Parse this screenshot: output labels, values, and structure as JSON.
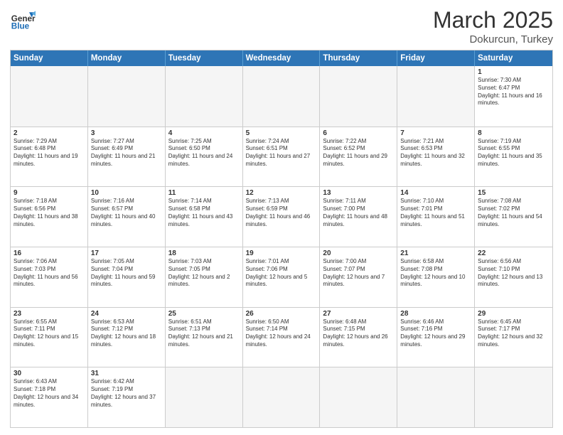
{
  "logo": {
    "text_general": "General",
    "text_blue": "Blue"
  },
  "title": "March 2025",
  "subtitle": "Dokurcun, Turkey",
  "header_days": [
    "Sunday",
    "Monday",
    "Tuesday",
    "Wednesday",
    "Thursday",
    "Friday",
    "Saturday"
  ],
  "weeks": [
    [
      {
        "day": "",
        "info": ""
      },
      {
        "day": "",
        "info": ""
      },
      {
        "day": "",
        "info": ""
      },
      {
        "day": "",
        "info": ""
      },
      {
        "day": "",
        "info": ""
      },
      {
        "day": "",
        "info": ""
      },
      {
        "day": "1",
        "info": "Sunrise: 7:30 AM\nSunset: 6:47 PM\nDaylight: 11 hours and 16 minutes."
      }
    ],
    [
      {
        "day": "2",
        "info": "Sunrise: 7:29 AM\nSunset: 6:48 PM\nDaylight: 11 hours and 19 minutes."
      },
      {
        "day": "3",
        "info": "Sunrise: 7:27 AM\nSunset: 6:49 PM\nDaylight: 11 hours and 21 minutes."
      },
      {
        "day": "4",
        "info": "Sunrise: 7:25 AM\nSunset: 6:50 PM\nDaylight: 11 hours and 24 minutes."
      },
      {
        "day": "5",
        "info": "Sunrise: 7:24 AM\nSunset: 6:51 PM\nDaylight: 11 hours and 27 minutes."
      },
      {
        "day": "6",
        "info": "Sunrise: 7:22 AM\nSunset: 6:52 PM\nDaylight: 11 hours and 29 minutes."
      },
      {
        "day": "7",
        "info": "Sunrise: 7:21 AM\nSunset: 6:53 PM\nDaylight: 11 hours and 32 minutes."
      },
      {
        "day": "8",
        "info": "Sunrise: 7:19 AM\nSunset: 6:55 PM\nDaylight: 11 hours and 35 minutes."
      }
    ],
    [
      {
        "day": "9",
        "info": "Sunrise: 7:18 AM\nSunset: 6:56 PM\nDaylight: 11 hours and 38 minutes."
      },
      {
        "day": "10",
        "info": "Sunrise: 7:16 AM\nSunset: 6:57 PM\nDaylight: 11 hours and 40 minutes."
      },
      {
        "day": "11",
        "info": "Sunrise: 7:14 AM\nSunset: 6:58 PM\nDaylight: 11 hours and 43 minutes."
      },
      {
        "day": "12",
        "info": "Sunrise: 7:13 AM\nSunset: 6:59 PM\nDaylight: 11 hours and 46 minutes."
      },
      {
        "day": "13",
        "info": "Sunrise: 7:11 AM\nSunset: 7:00 PM\nDaylight: 11 hours and 48 minutes."
      },
      {
        "day": "14",
        "info": "Sunrise: 7:10 AM\nSunset: 7:01 PM\nDaylight: 11 hours and 51 minutes."
      },
      {
        "day": "15",
        "info": "Sunrise: 7:08 AM\nSunset: 7:02 PM\nDaylight: 11 hours and 54 minutes."
      }
    ],
    [
      {
        "day": "16",
        "info": "Sunrise: 7:06 AM\nSunset: 7:03 PM\nDaylight: 11 hours and 56 minutes."
      },
      {
        "day": "17",
        "info": "Sunrise: 7:05 AM\nSunset: 7:04 PM\nDaylight: 11 hours and 59 minutes."
      },
      {
        "day": "18",
        "info": "Sunrise: 7:03 AM\nSunset: 7:05 PM\nDaylight: 12 hours and 2 minutes."
      },
      {
        "day": "19",
        "info": "Sunrise: 7:01 AM\nSunset: 7:06 PM\nDaylight: 12 hours and 5 minutes."
      },
      {
        "day": "20",
        "info": "Sunrise: 7:00 AM\nSunset: 7:07 PM\nDaylight: 12 hours and 7 minutes."
      },
      {
        "day": "21",
        "info": "Sunrise: 6:58 AM\nSunset: 7:08 PM\nDaylight: 12 hours and 10 minutes."
      },
      {
        "day": "22",
        "info": "Sunrise: 6:56 AM\nSunset: 7:10 PM\nDaylight: 12 hours and 13 minutes."
      }
    ],
    [
      {
        "day": "23",
        "info": "Sunrise: 6:55 AM\nSunset: 7:11 PM\nDaylight: 12 hours and 15 minutes."
      },
      {
        "day": "24",
        "info": "Sunrise: 6:53 AM\nSunset: 7:12 PM\nDaylight: 12 hours and 18 minutes."
      },
      {
        "day": "25",
        "info": "Sunrise: 6:51 AM\nSunset: 7:13 PM\nDaylight: 12 hours and 21 minutes."
      },
      {
        "day": "26",
        "info": "Sunrise: 6:50 AM\nSunset: 7:14 PM\nDaylight: 12 hours and 24 minutes."
      },
      {
        "day": "27",
        "info": "Sunrise: 6:48 AM\nSunset: 7:15 PM\nDaylight: 12 hours and 26 minutes."
      },
      {
        "day": "28",
        "info": "Sunrise: 6:46 AM\nSunset: 7:16 PM\nDaylight: 12 hours and 29 minutes."
      },
      {
        "day": "29",
        "info": "Sunrise: 6:45 AM\nSunset: 7:17 PM\nDaylight: 12 hours and 32 minutes."
      }
    ],
    [
      {
        "day": "30",
        "info": "Sunrise: 6:43 AM\nSunset: 7:18 PM\nDaylight: 12 hours and 34 minutes."
      },
      {
        "day": "31",
        "info": "Sunrise: 6:42 AM\nSunset: 7:19 PM\nDaylight: 12 hours and 37 minutes."
      },
      {
        "day": "",
        "info": ""
      },
      {
        "day": "",
        "info": ""
      },
      {
        "day": "",
        "info": ""
      },
      {
        "day": "",
        "info": ""
      },
      {
        "day": "",
        "info": ""
      }
    ]
  ]
}
